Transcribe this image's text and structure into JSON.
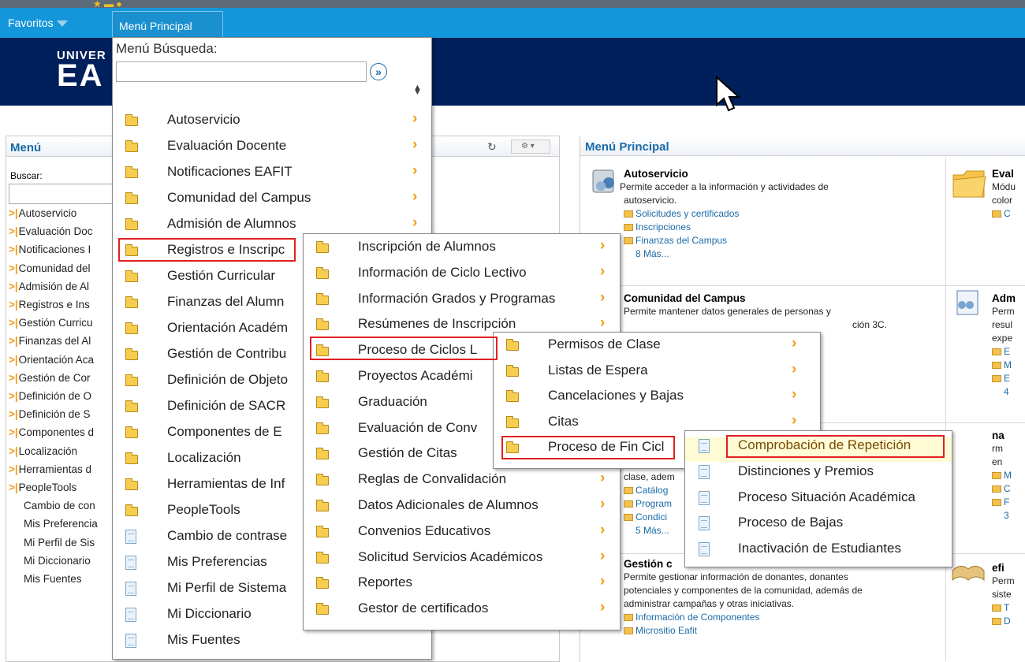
{
  "favorites_label": "Favoritos",
  "main_menu_tab": "Menú Principal",
  "logo": {
    "line1": "UNIVER",
    "line2": "EA"
  },
  "left_panel": {
    "title": "Menú",
    "search_label": "Buscar:",
    "items": [
      {
        "label": "Autoservicio",
        "folder": true
      },
      {
        "label": "Evaluación Doc",
        "folder": true
      },
      {
        "label": "Notificaciones I",
        "folder": true
      },
      {
        "label": "Comunidad del",
        "folder": true
      },
      {
        "label": "Admisión de Al",
        "folder": true
      },
      {
        "label": "Registros e Ins",
        "folder": true
      },
      {
        "label": "Gestión Curricu",
        "folder": true
      },
      {
        "label": "Finanzas del Al",
        "folder": true
      },
      {
        "label": "Orientación Aca",
        "folder": true
      },
      {
        "label": "Gestión de Cor",
        "folder": true
      },
      {
        "label": "Definición de O",
        "folder": true
      },
      {
        "label": "Definición de S",
        "folder": true
      },
      {
        "label": "Componentes d",
        "folder": true
      },
      {
        "label": "Localización",
        "folder": true
      },
      {
        "label": "Herramientas d",
        "folder": true
      },
      {
        "label": "PeopleTools",
        "folder": true
      },
      {
        "label": "Cambio de con",
        "folder": false
      },
      {
        "label": "Mis Preferencia",
        "folder": false
      },
      {
        "label": "Mi Perfil de Sis",
        "folder": false
      },
      {
        "label": "Mi Diccionario",
        "folder": false
      },
      {
        "label": "Mis Fuentes",
        "folder": false
      }
    ]
  },
  "right_panel": {
    "title": "Menú Principal",
    "sections": [
      {
        "title": "Autoservicio",
        "desc": [
          "Permite acceder a la información y actividades de",
          "autoservicio."
        ],
        "links": [
          "Solicitudes y certificados",
          "Inscripciones",
          "Finanzas del Campus"
        ],
        "more": "8 Más..."
      },
      {
        "title": "Comunidad del Campus",
        "desc": [
          "Permite mantener datos generales de personas y",
          "ción 3C."
        ],
        "links": [],
        "more": ""
      },
      {
        "title": "Gestión c",
        "desc": [
          "Permite gestionar información de donantes, donantes",
          "potenciales y componentes de la comunidad, además de",
          "administrar campañas y otras iniciativas."
        ],
        "links": [
          "Información de Componentes",
          "Micrositio Eafit"
        ],
        "more": ""
      },
      {
        "title": "",
        "desc": [
          "clase, adem"
        ],
        "links": [
          "Catálog",
          "Program",
          "Condici"
        ],
        "more": "5 Más..."
      }
    ],
    "col2": {
      "eval": {
        "title": "Eval",
        "desc": [
          "Módu",
          "color"
        ],
        "links": [
          "C"
        ]
      },
      "adm": {
        "title": "Adm",
        "desc": [
          "Perm",
          "resul",
          "expe"
        ],
        "links": [
          "E",
          "M",
          "E"
        ],
        "more": "4"
      },
      "na": {
        "title": "na",
        "desc": [
          "rm",
          "en"
        ],
        "links": [
          "M",
          "C",
          "F"
        ],
        "more": "3"
      },
      "efi": {
        "title": "efi",
        "desc": [
          "Perm",
          "siste"
        ],
        "links": [
          "T",
          "D"
        ]
      }
    }
  },
  "menu1": {
    "search_label": "Menú Búsqueda:",
    "items": [
      {
        "label": "Autoservicio",
        "type": "folder"
      },
      {
        "label": "Evaluación Docente",
        "type": "folder"
      },
      {
        "label": "Notificaciones EAFIT",
        "type": "folder"
      },
      {
        "label": "Comunidad del Campus",
        "type": "folder"
      },
      {
        "label": "Admisión de Alumnos",
        "type": "folder"
      },
      {
        "label": "Registros e Inscripc",
        "type": "folder"
      },
      {
        "label": "Gestión Curricular",
        "type": "folder"
      },
      {
        "label": "Finanzas del Alumn",
        "type": "folder"
      },
      {
        "label": "Orientación Académ",
        "type": "folder"
      },
      {
        "label": "Gestión de Contribu",
        "type": "folder"
      },
      {
        "label": "Definición de Objeto",
        "type": "folder"
      },
      {
        "label": "Definición de SACR",
        "type": "folder"
      },
      {
        "label": "Componentes de E",
        "type": "folder"
      },
      {
        "label": "Localización",
        "type": "folder"
      },
      {
        "label": "Herramientas de Inf",
        "type": "folder"
      },
      {
        "label": "PeopleTools",
        "type": "folder"
      },
      {
        "label": "Cambio de contrase",
        "type": "doc"
      },
      {
        "label": "Mis Preferencias",
        "type": "doc"
      },
      {
        "label": "Mi Perfil de Sistema",
        "type": "doc"
      },
      {
        "label": "Mi Diccionario",
        "type": "doc"
      },
      {
        "label": "Mis Fuentes",
        "type": "doc"
      }
    ]
  },
  "menu2": {
    "items": [
      {
        "label": "Inscripción de Alumnos"
      },
      {
        "label": "Información de Ciclo Lectivo"
      },
      {
        "label": "Información Grados y Programas"
      },
      {
        "label": "Resúmenes de Inscripción"
      },
      {
        "label": "Proceso de Ciclos L"
      },
      {
        "label": "Proyectos Académi"
      },
      {
        "label": "Graduación"
      },
      {
        "label": "Evaluación de Conv"
      },
      {
        "label": "Gestión de Citas"
      },
      {
        "label": "Reglas de Convalidación"
      },
      {
        "label": "Datos Adicionales de Alumnos"
      },
      {
        "label": "Convenios Educativos"
      },
      {
        "label": "Solicitud Servicios Académicos"
      },
      {
        "label": "Reportes"
      },
      {
        "label": "Gestor de certificados"
      }
    ]
  },
  "menu3": {
    "items": [
      {
        "label": "Permisos de Clase"
      },
      {
        "label": "Listas de Espera"
      },
      {
        "label": "Cancelaciones y Bajas"
      },
      {
        "label": "Citas"
      },
      {
        "label": "Proceso de Fin Cicl"
      }
    ]
  },
  "menu4": {
    "items": [
      {
        "label": "Comprobación de Repetición"
      },
      {
        "label": "Distinciones y Premios"
      },
      {
        "label": "Proceso Situación Académica"
      },
      {
        "label": "Proceso de Bajas"
      },
      {
        "label": "Inactivación de Estudiantes"
      }
    ]
  }
}
